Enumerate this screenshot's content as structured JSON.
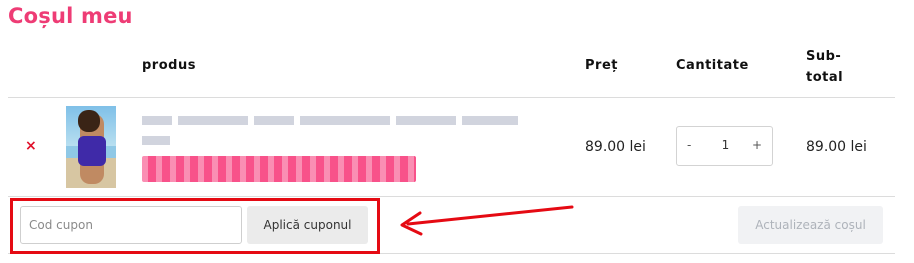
{
  "page": {
    "title": "Coșul meu"
  },
  "table": {
    "headers": {
      "product": "produs",
      "price": "Preț",
      "quantity": "Cantitate",
      "subtotal": "Sub-total"
    }
  },
  "cart_item": {
    "remove_icon": "×",
    "price": "89.00 lei",
    "quantity": "1",
    "minus_label": "-",
    "plus_label": "+",
    "subtotal": "89.00 lei"
  },
  "coupon": {
    "placeholder": "Cod cupon",
    "value": "",
    "apply_label": "Aplică cuponul"
  },
  "update_cart_label": "Actualizează coșul",
  "colors": {
    "title": "#ee3c75",
    "annotation": "#e50a13",
    "remove": "#e0102a"
  }
}
